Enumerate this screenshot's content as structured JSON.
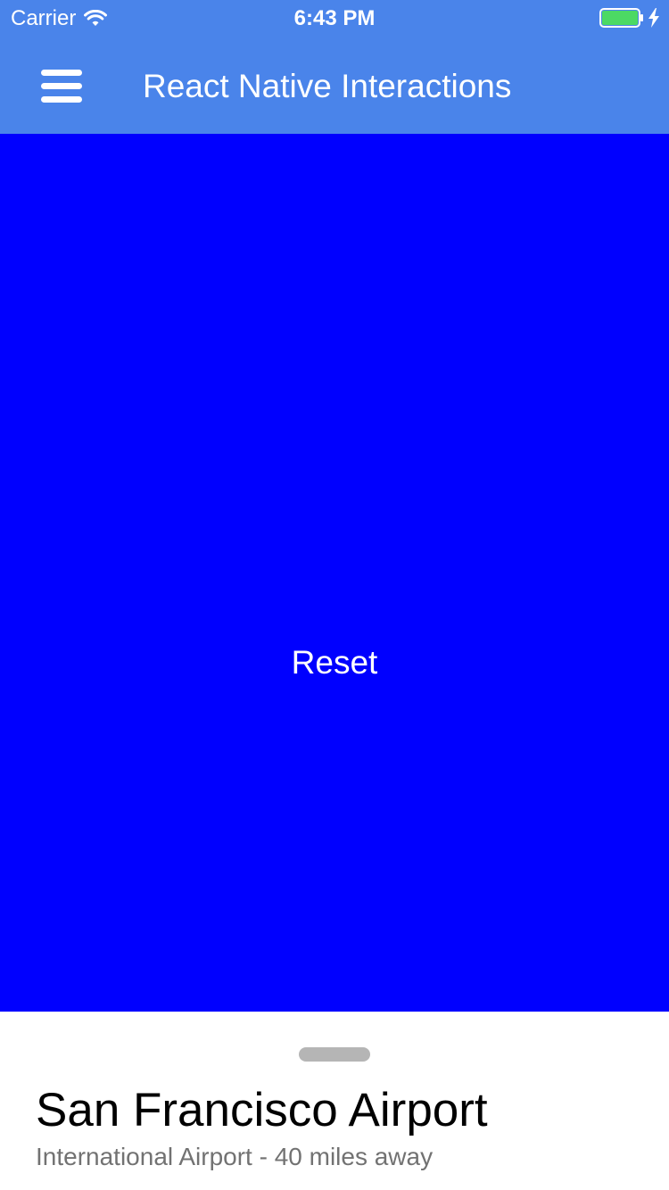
{
  "status_bar": {
    "carrier": "Carrier",
    "time": "6:43 PM",
    "wifi_icon": "wifi-icon",
    "battery_icon": "battery-icon",
    "charging_icon": "bolt-icon",
    "battery_level": 1.0,
    "battery_color": "#4cd964"
  },
  "nav_bar": {
    "menu_icon": "hamburger-menu-icon",
    "title": "React Native Interactions",
    "background_color": "#4a84ea"
  },
  "main": {
    "background_color": "#0000ff",
    "reset_label": "Reset"
  },
  "bottom_sheet": {
    "title": "San Francisco Airport",
    "subtitle": "International Airport - 40 miles away"
  }
}
